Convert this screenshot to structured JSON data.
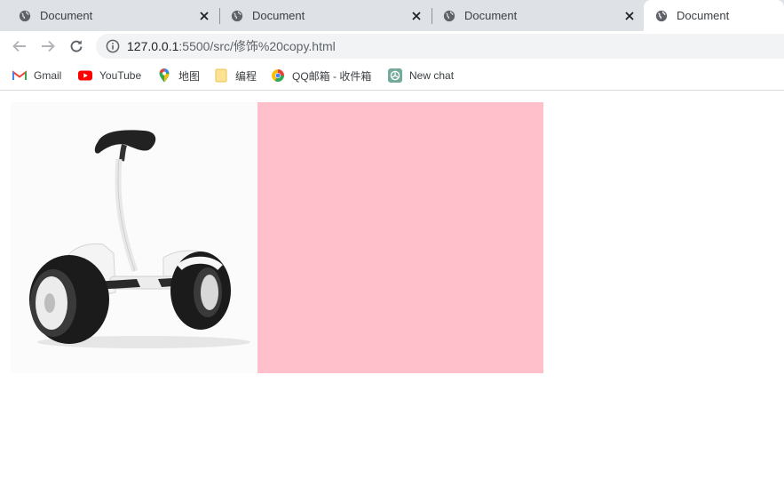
{
  "tabs": [
    {
      "title": "Document",
      "active": false
    },
    {
      "title": "Document",
      "active": false
    },
    {
      "title": "Document",
      "active": false
    },
    {
      "title": "Document",
      "active": true
    }
  ],
  "address": {
    "host": "127.0.0.1",
    "path": ":5500/src/修饰%20copy.html"
  },
  "bookmarks": [
    {
      "label": "Gmail",
      "icon": "gmail-icon"
    },
    {
      "label": "YouTube",
      "icon": "youtube-icon"
    },
    {
      "label": "地图",
      "icon": "maps-icon"
    },
    {
      "label": "编程",
      "icon": "folder-icon"
    },
    {
      "label": "QQ邮箱 - 收件箱",
      "icon": "qqmail-icon"
    },
    {
      "label": "New chat",
      "icon": "chatgpt-icon"
    }
  ],
  "page": {
    "image_name": "self-balancing-scooter",
    "box_color": "#ffc0cb"
  },
  "colors": {
    "tabstrip": "#dee1e6",
    "omnibox": "#f1f3f4",
    "pink": "#ffc0cb"
  }
}
